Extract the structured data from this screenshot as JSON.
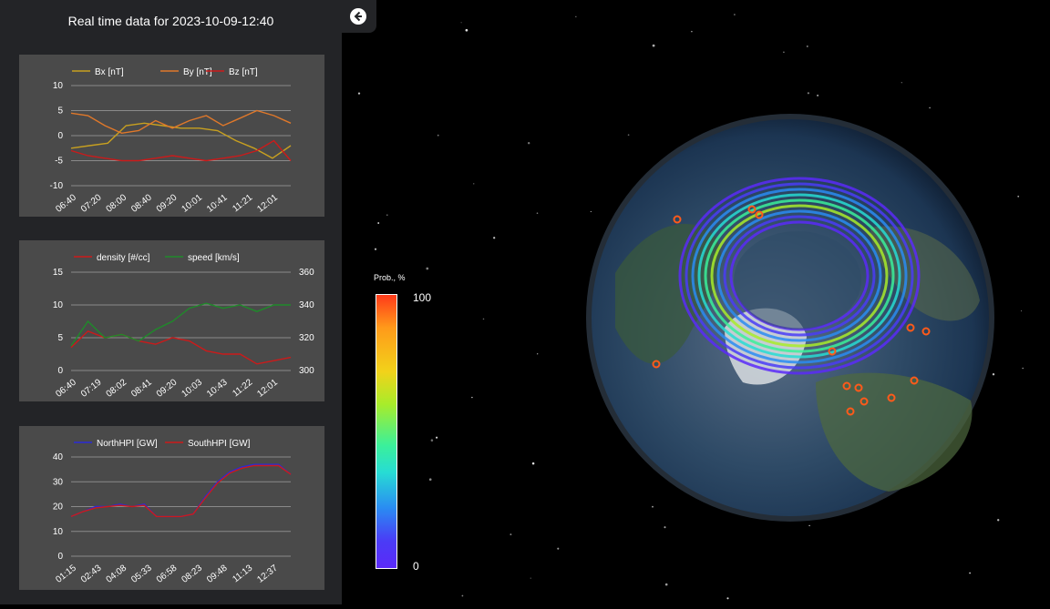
{
  "sidebar": {
    "title": "Real time data for 2023-10-09-12:40"
  },
  "colorbar": {
    "title": "Prob., %",
    "max_label": "100",
    "min_label": "0"
  },
  "icons": {
    "back": "arrow-left-circle-icon"
  },
  "chart_data": [
    {
      "type": "line",
      "legend_placement": "top",
      "grid": true,
      "ylim": [
        -10,
        10
      ],
      "y_ticks": [
        "10",
        "5",
        "0",
        "-5",
        "-10"
      ],
      "x_ticks": [
        "06:40",
        "07:20",
        "08:00",
        "08:40",
        "09:20",
        "10:01",
        "10:41",
        "11:21",
        "12:01"
      ],
      "series": [
        {
          "name": "Bx [nT]",
          "color": "#c8a020",
          "values": [
            -2.5,
            -2,
            -1.5,
            2,
            2.5,
            2,
            1.5,
            1.5,
            1,
            -1,
            -2.5,
            -4.5,
            -2
          ]
        },
        {
          "name": "By [nT]",
          "color": "#e0782a",
          "values": [
            4.5,
            4,
            2,
            0.5,
            1,
            3,
            1.5,
            3,
            4,
            2,
            3.5,
            5,
            4,
            2.5
          ]
        },
        {
          "name": "Bz [nT]",
          "color": "#cc1a1a",
          "values": [
            -3,
            -4,
            -4.5,
            -5,
            -5,
            -4.5,
            -4,
            -4.5,
            -5,
            -4.5,
            -4,
            -3,
            -1,
            -5
          ]
        }
      ]
    },
    {
      "type": "line",
      "legend_placement": "top",
      "grid": true,
      "ylim_left": [
        0,
        15
      ],
      "ylim_right": [
        300,
        360
      ],
      "y_ticks_left": [
        "15",
        "10",
        "5",
        "0"
      ],
      "y_ticks_right": [
        "360",
        "340",
        "320",
        "300"
      ],
      "x_ticks": [
        "06:40",
        "07:19",
        "08:02",
        "08:41",
        "09:20",
        "10:03",
        "10:43",
        "11:22",
        "12:01"
      ],
      "series": [
        {
          "name": "density [#/cc]",
          "color": "#cc1a1a",
          "axis": "left",
          "values": [
            3.5,
            6,
            5,
            5.5,
            4.5,
            4,
            5,
            4.5,
            3,
            2.5,
            2.5,
            1,
            1.5,
            2
          ]
        },
        {
          "name": "speed [km/s]",
          "color": "#1f8a2a",
          "axis": "right",
          "values": [
            315,
            330,
            320,
            322,
            318,
            325,
            330,
            338,
            341,
            338,
            340,
            336,
            340,
            340
          ]
        }
      ]
    },
    {
      "type": "line",
      "legend_placement": "top",
      "grid": true,
      "ylim": [
        0,
        40
      ],
      "y_ticks": [
        "40",
        "30",
        "20",
        "10",
        "0"
      ],
      "x_ticks": [
        "01:15",
        "02:43",
        "04:08",
        "05:33",
        "06:58",
        "08:23",
        "09:48",
        "11:13",
        "12:37"
      ],
      "series": [
        {
          "name": "NorthHPI [GW]",
          "color": "#2a2ad8",
          "values": [
            16,
            18,
            20,
            20,
            21,
            20,
            21,
            16,
            16,
            16,
            17,
            24,
            30,
            34,
            36,
            37,
            37,
            37,
            33
          ]
        },
        {
          "name": "SouthHPI [GW]",
          "color": "#cc1a1a",
          "values": [
            16,
            18,
            19.5,
            20,
            20.5,
            20,
            20.5,
            16,
            16,
            16,
            17,
            23.5,
            29.5,
            33.5,
            35.5,
            36.5,
            36.5,
            36.5,
            33
          ]
        }
      ]
    }
  ]
}
